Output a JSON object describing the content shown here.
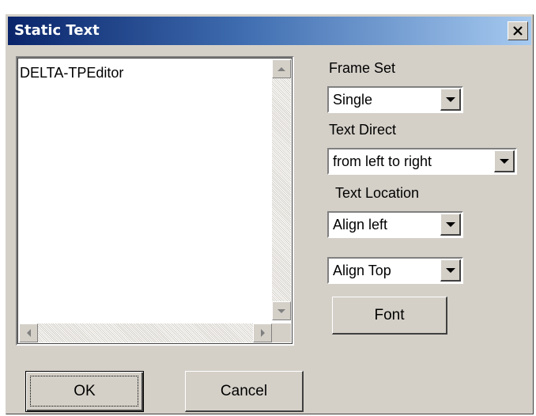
{
  "window": {
    "title": "Static Text",
    "close_label": "✕"
  },
  "editor": {
    "text": "DELTA-TPEditor"
  },
  "frame_set": {
    "label": "Frame Set",
    "value": "Single"
  },
  "text_direct": {
    "label": "Text Direct",
    "value": "from left to right"
  },
  "text_location": {
    "label": "Text Location",
    "horizontal_value": "Align left",
    "vertical_value": "Align Top"
  },
  "buttons": {
    "font": "Font",
    "ok": "OK",
    "cancel": "Cancel"
  },
  "colors": {
    "title_gradient_start": "#0a246a",
    "title_gradient_end": "#a6caf0",
    "face": "#d4d0c8"
  }
}
